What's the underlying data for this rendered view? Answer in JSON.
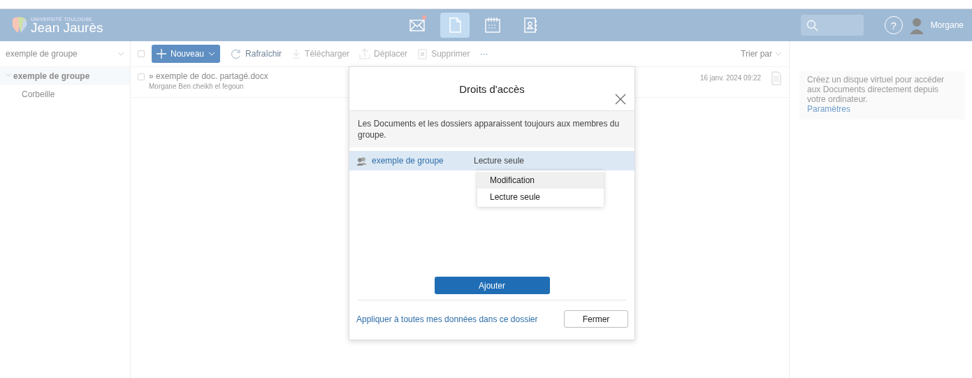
{
  "header": {
    "logo": {
      "line_1": "UNIVERSITÉ TOULOUSE",
      "line_2": "Jean Jaurès"
    },
    "apps": [
      {
        "kind": "mail",
        "selected": false,
        "unread": true
      },
      {
        "kind": "documents",
        "selected": true,
        "unread": false
      },
      {
        "kind": "calendar",
        "selected": false,
        "unread": false
      },
      {
        "kind": "contacts",
        "selected": false,
        "unread": false
      }
    ],
    "help": "?",
    "user": {
      "name": "Morgane"
    }
  },
  "sidebar": {
    "group_select": "exemple de groupe",
    "tree": [
      {
        "label": "exemple de groupe",
        "selected": true,
        "expanded": true,
        "children": [
          {
            "label": "Corbeille",
            "selected": false
          }
        ]
      }
    ]
  },
  "toolbar": {
    "select_all": false,
    "buttons": [
      {
        "kind": "new",
        "label": "Nouveau",
        "disabled": false
      },
      {
        "kind": "refresh",
        "label": "Rafraîchir",
        "disabled": false
      },
      {
        "kind": "download",
        "label": "Télécharger",
        "disabled": true
      },
      {
        "kind": "move",
        "label": "Déplacer",
        "disabled": true
      },
      {
        "kind": "delete",
        "label": "Supprimer",
        "disabled": true
      },
      {
        "kind": "more",
        "label": "···",
        "disabled": false
      }
    ],
    "sort": "Trier par"
  },
  "files": [
    {
      "name": "» exemple de doc. partagé.docx",
      "owner": "Morgane Ben cheikh el fegoun",
      "date": "16 janv. 2024 09:22",
      "checked": false
    }
  ],
  "info_panel": {
    "text": "Créez un disque virtuel pour accéder aux Documents directement depuis votre ordinateur.",
    "link": "Paramètres"
  },
  "dialog": {
    "title": "Droits d'accès",
    "notice": "Les Documents et les dossiers apparaissent toujours aux membres du groupe.",
    "members": [
      {
        "name": "exemple de groupe",
        "right": "Lecture seule",
        "selected": true
      }
    ],
    "menu": [
      {
        "label": "Modification",
        "highlighted": true
      },
      {
        "label": "Lecture seule",
        "highlighted": false
      }
    ],
    "add_button": "Ajouter",
    "apply_link": "Appliquer à toutes mes données dans ce dossier",
    "close_button": "Fermer"
  }
}
